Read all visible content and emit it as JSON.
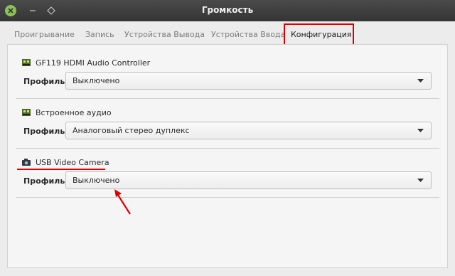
{
  "window": {
    "title": "Громкость"
  },
  "tabs": [
    {
      "label": "Проигрывание"
    },
    {
      "label": "Запись"
    },
    {
      "label": "Устройства Вывода"
    },
    {
      "label": "Устройства Ввода"
    },
    {
      "label": "Конфигурация",
      "active": true
    }
  ],
  "profile_label": "Профиль:",
  "devices": [
    {
      "name": "GF119 HDMI Audio Controller",
      "icon": "sound-card-icon",
      "profile": "Выключено"
    },
    {
      "name": "Встроенное аудио",
      "icon": "sound-card-icon",
      "profile": "Аналоговый стерео дуплекс"
    },
    {
      "name": "USB Video Camera",
      "icon": "camera-icon",
      "profile": "Выключено"
    }
  ],
  "colors": {
    "annotation": "#e00000",
    "titlebar": "#3c3c3c",
    "close_button": "#8fbf5a"
  }
}
